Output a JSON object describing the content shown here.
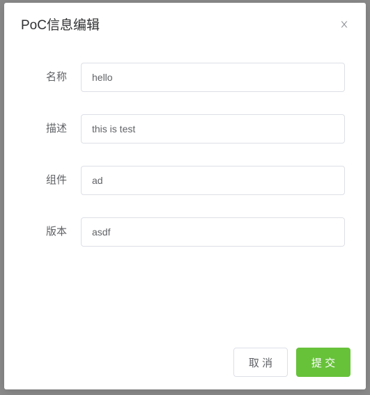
{
  "modal": {
    "title": "PoC信息编辑"
  },
  "form": {
    "name_label": "名称",
    "name_value": "hello",
    "desc_label": "描述",
    "desc_value": "this is test",
    "component_label": "组件",
    "component_value": "ad",
    "version_label": "版本",
    "version_value": "asdf"
  },
  "footer": {
    "cancel_label": "取 消",
    "submit_label": "提 交"
  }
}
